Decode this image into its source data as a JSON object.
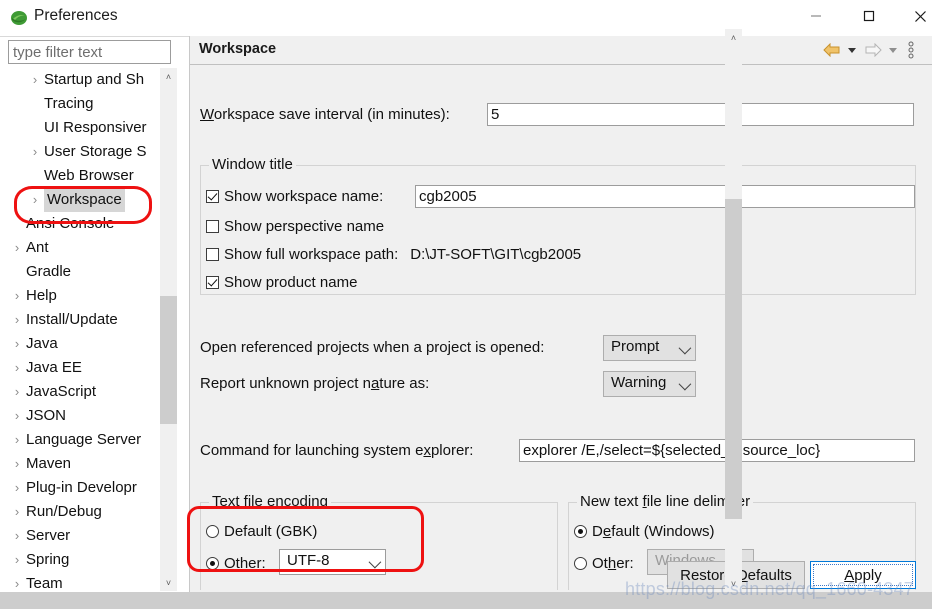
{
  "window": {
    "title": "Preferences",
    "app_icon": "eclipse-icon",
    "minimize_label": "Minimize",
    "maximize_label": "Maximize",
    "close_label": "Close"
  },
  "filter": {
    "placeholder": "type filter text",
    "value": ""
  },
  "tree": {
    "items": [
      {
        "label": "Startup and Sh",
        "level": 2,
        "expandable": true,
        "selected": false
      },
      {
        "label": "Tracing",
        "level": 2,
        "expandable": false,
        "selected": false
      },
      {
        "label": "UI Responsiver",
        "level": 2,
        "expandable": false,
        "selected": false
      },
      {
        "label": "User Storage S",
        "level": 2,
        "expandable": true,
        "selected": false
      },
      {
        "label": "Web Browser",
        "level": 2,
        "expandable": false,
        "selected": false
      },
      {
        "label": "Workspace",
        "level": 2,
        "expandable": true,
        "selected": true
      },
      {
        "label": "Ansi Console",
        "level": 1,
        "expandable": false,
        "selected": false
      },
      {
        "label": "Ant",
        "level": 1,
        "expandable": true,
        "selected": false
      },
      {
        "label": "Gradle",
        "level": 1,
        "expandable": false,
        "selected": false
      },
      {
        "label": "Help",
        "level": 1,
        "expandable": true,
        "selected": false
      },
      {
        "label": "Install/Update",
        "level": 1,
        "expandable": true,
        "selected": false
      },
      {
        "label": "Java",
        "level": 1,
        "expandable": true,
        "selected": false
      },
      {
        "label": "Java EE",
        "level": 1,
        "expandable": true,
        "selected": false
      },
      {
        "label": "JavaScript",
        "level": 1,
        "expandable": true,
        "selected": false
      },
      {
        "label": "JSON",
        "level": 1,
        "expandable": true,
        "selected": false
      },
      {
        "label": "Language Server",
        "level": 1,
        "expandable": true,
        "selected": false
      },
      {
        "label": "Maven",
        "level": 1,
        "expandable": true,
        "selected": false
      },
      {
        "label": "Plug-in Developr",
        "level": 1,
        "expandable": true,
        "selected": false
      },
      {
        "label": "Run/Debug",
        "level": 1,
        "expandable": true,
        "selected": false
      },
      {
        "label": "Server",
        "level": 1,
        "expandable": true,
        "selected": false
      },
      {
        "label": "Spring",
        "level": 1,
        "expandable": true,
        "selected": false
      },
      {
        "label": "Team",
        "level": 1,
        "expandable": true,
        "selected": false
      }
    ],
    "expand_glyph": "›"
  },
  "panel": {
    "title": "Workspace",
    "nav": {
      "back_icon": "back-arrow-icon",
      "back_menu_icon": "chevron-down-icon",
      "forward_icon": "forward-arrow-icon",
      "forward_menu_icon": "chevron-down-icon",
      "menu_icon": "view-menu-icon"
    },
    "save_interval": {
      "label": "Workspace save interval (in minutes):",
      "value": "5"
    },
    "window_title_group": {
      "title": "Window title",
      "show_workspace_name": {
        "label": "Show workspace name:",
        "checked": true,
        "value": "cgb2005"
      },
      "show_perspective_name": {
        "label": "Show perspective name",
        "checked": false
      },
      "show_full_workspace_path": {
        "label": "Show full workspace path:",
        "checked": false,
        "path": "D:\\JT-SOFT\\GIT\\cgb2005"
      },
      "show_product_name": {
        "label": "Show product name",
        "checked": true
      }
    },
    "open_referenced": {
      "label": "Open referenced projects when a project is opened:",
      "value": "Prompt"
    },
    "report_nature": {
      "label": "Report unknown project nature as:",
      "value": "Warning"
    },
    "system_explorer": {
      "label": "Command for launching system explorer:",
      "value": "explorer /E,/select=${selected_resource_loc}"
    },
    "text_file_encoding": {
      "title": "Text file encoding",
      "default_label": "Default (GBK)",
      "default_selected": false,
      "other_label": "Other:",
      "other_selected": true,
      "other_value": "UTF-8"
    },
    "line_delimiter": {
      "title": "New text file line delimiter",
      "default_label": "Default (Windows)",
      "default_selected": true,
      "other_label": "Other:",
      "other_selected": false,
      "other_value": "Windows"
    },
    "buttons": {
      "restore_defaults": "Restore Defaults",
      "apply": "Apply"
    }
  },
  "scrollbars": {
    "up_glyph": "˄",
    "down_glyph": "˅",
    "left_glyph": "‹",
    "right_glyph": "›"
  },
  "watermark": {
    "text": "https://blog.csdn.net/qq_1660-4347"
  },
  "colors": {
    "accent": "#0078d7",
    "annotation": "#ee1111",
    "panel_bg": "#f0f0f0",
    "selection": "#d6d6d6",
    "back_arrow": "#e8a33d"
  }
}
